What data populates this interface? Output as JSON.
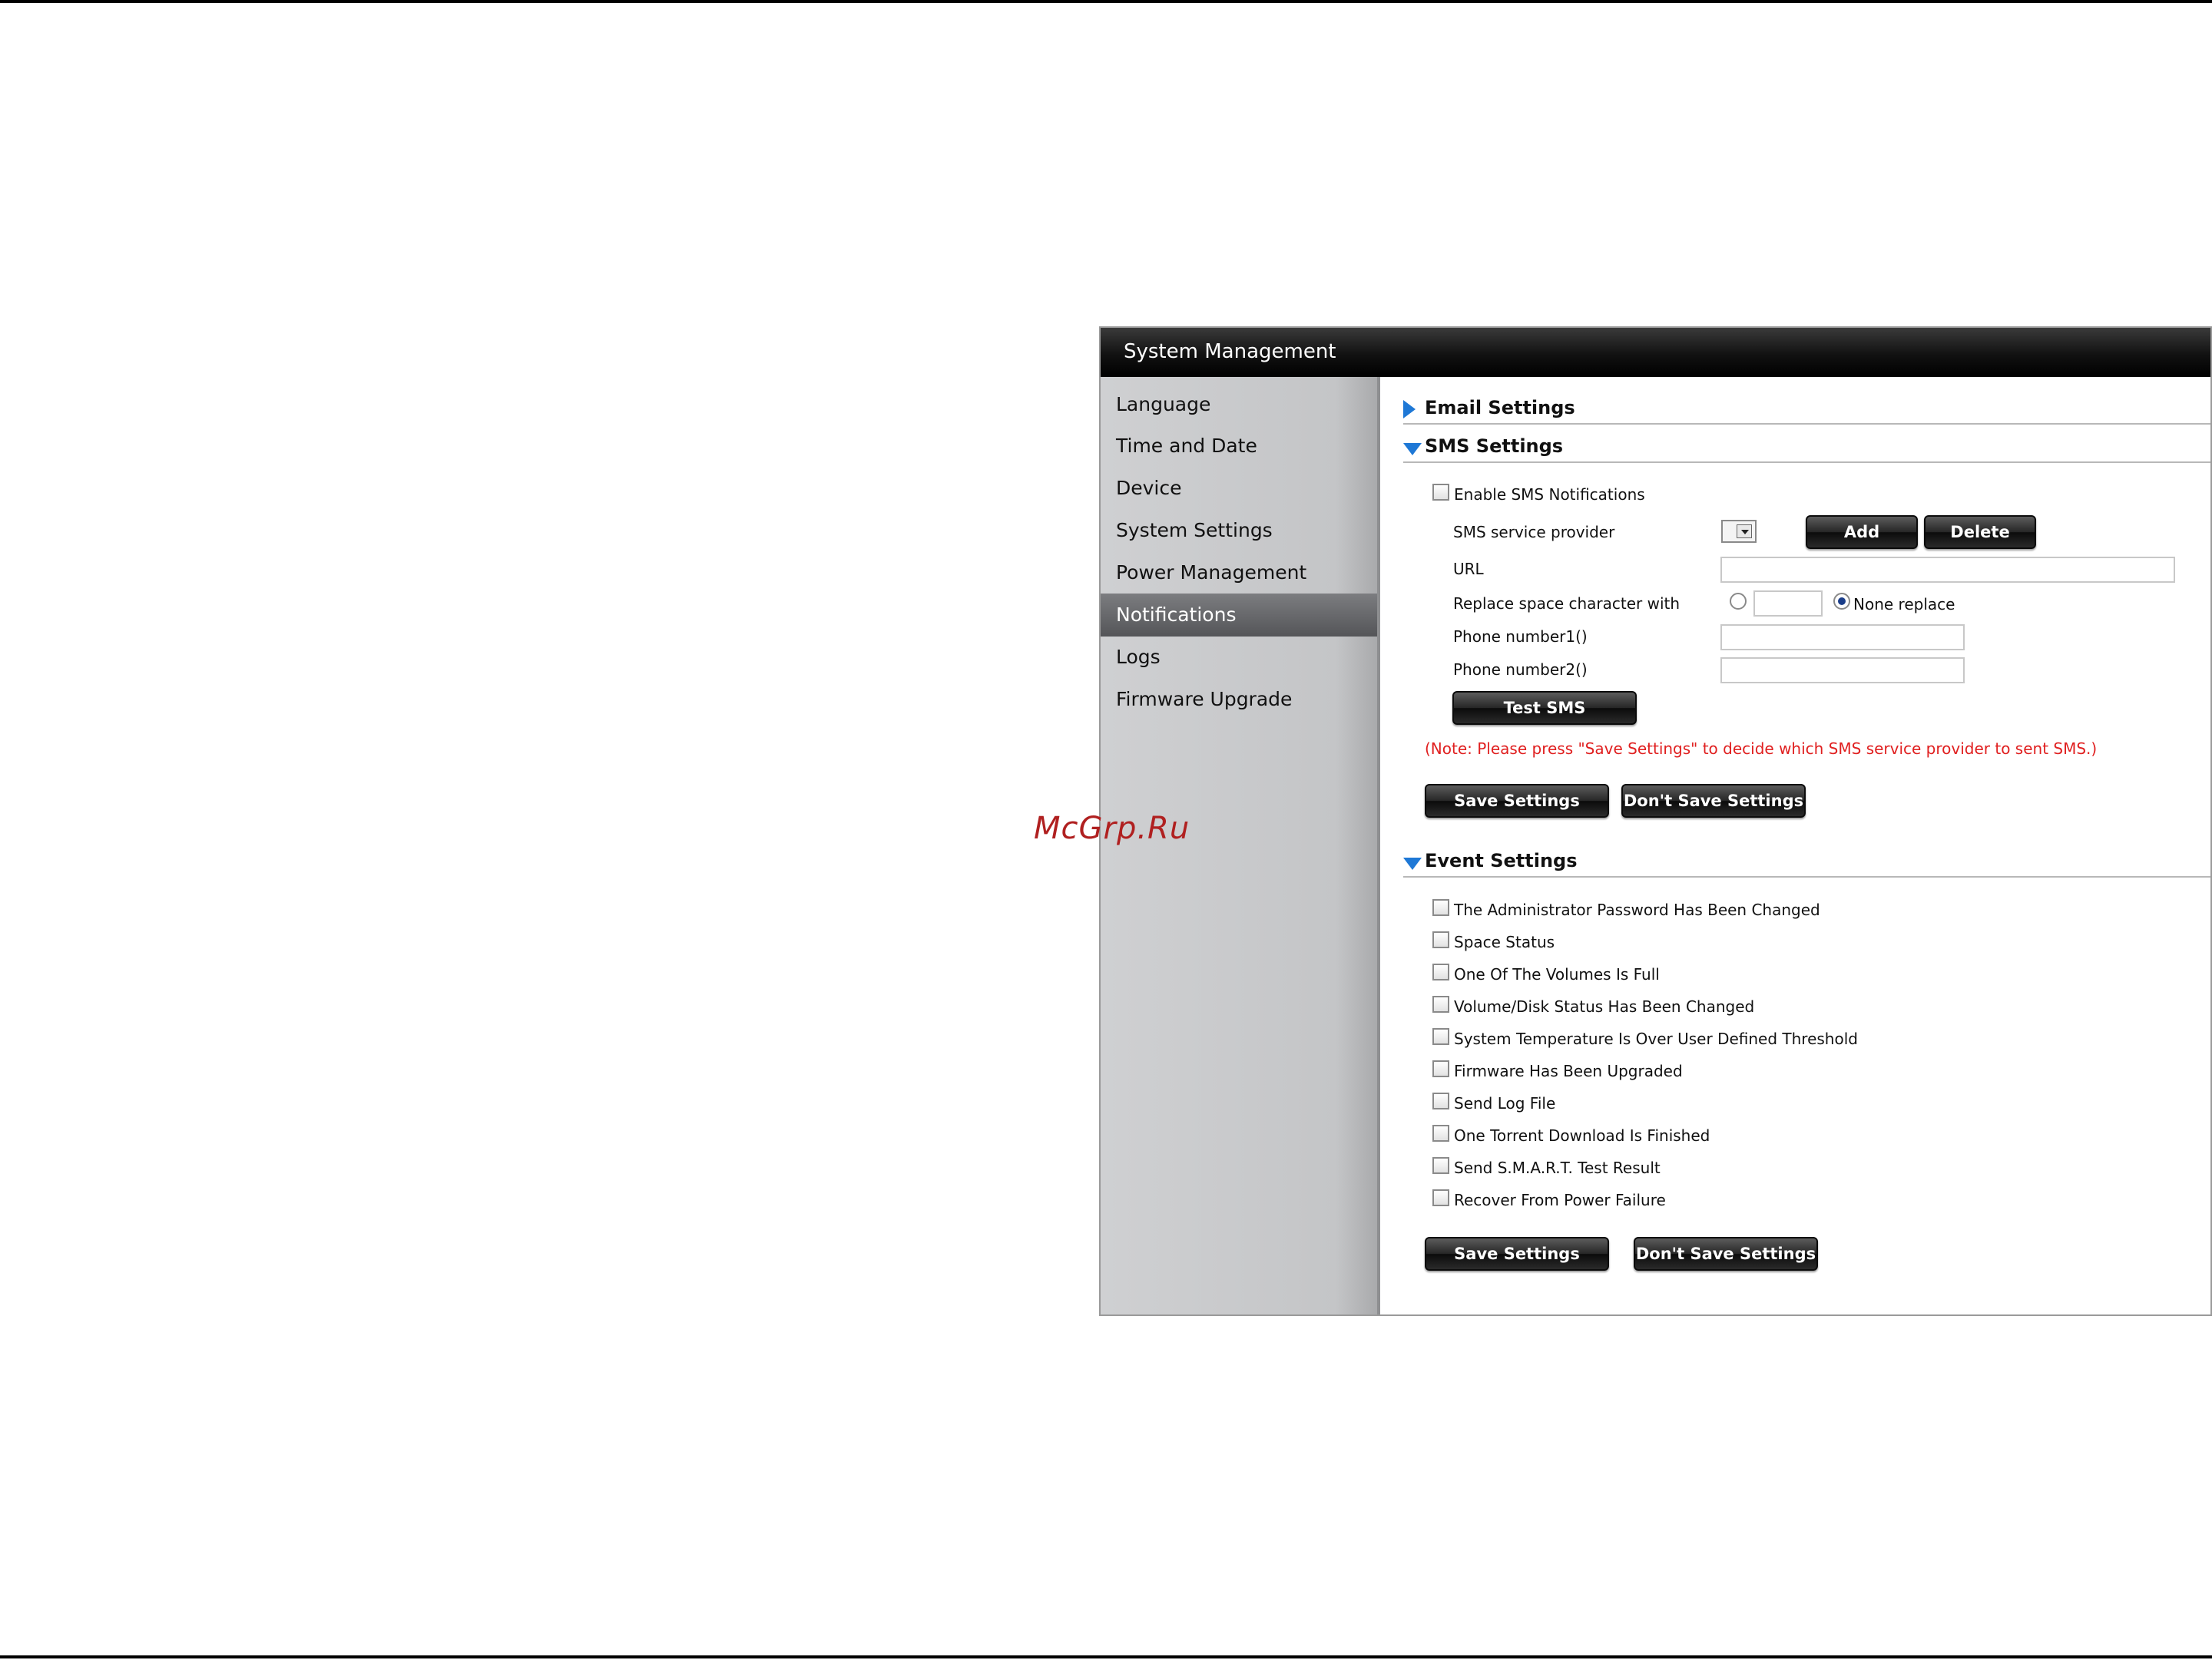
{
  "window": {
    "title": "System Management"
  },
  "sidebar": {
    "items": [
      {
        "label": "Language",
        "active": false
      },
      {
        "label": "Time and Date",
        "active": false
      },
      {
        "label": "Device",
        "active": false
      },
      {
        "label": "System Settings",
        "active": false
      },
      {
        "label": "Power Management",
        "active": false
      },
      {
        "label": "Notifications",
        "active": true
      },
      {
        "label": "Logs",
        "active": false
      },
      {
        "label": "Firmware Upgrade",
        "active": false
      }
    ]
  },
  "email_settings": {
    "title": "Email Settings",
    "expanded": false
  },
  "sms_settings": {
    "title": "SMS Settings",
    "expanded": true,
    "enable_label": "Enable SMS Notifications",
    "enable_checked": false,
    "provider_label": "SMS service provider",
    "provider_value": "",
    "add_button": "Add",
    "delete_button": "Delete",
    "url_label": "URL",
    "url_value": "",
    "replace_label": "Replace space character with",
    "replace_value": "",
    "none_replace_label": "None replace",
    "none_replace_selected": true,
    "phone1_label": "Phone number1()",
    "phone1_value": "",
    "phone2_label": "Phone number2()",
    "phone2_value": "",
    "test_button": "Test SMS",
    "note": "(Note: Please press \"Save Settings\" to decide which SMS service provider to sent SMS.)",
    "save_button": "Save Settings",
    "dont_save_button": "Don't Save Settings"
  },
  "event_settings": {
    "title": "Event Settings",
    "expanded": true,
    "events": [
      {
        "label": "The Administrator Password Has Been Changed",
        "checked": false
      },
      {
        "label": "Space Status",
        "checked": false
      },
      {
        "label": "One Of The Volumes Is Full",
        "checked": false
      },
      {
        "label": "Volume/Disk Status Has Been Changed",
        "checked": false
      },
      {
        "label": "System Temperature Is Over User Defined Threshold",
        "checked": false
      },
      {
        "label": "Firmware Has Been Upgraded",
        "checked": false
      },
      {
        "label": "Send Log File",
        "checked": false
      },
      {
        "label": "One Torrent Download Is Finished",
        "checked": false
      },
      {
        "label": "Send S.M.A.R.T. Test Result",
        "checked": false
      },
      {
        "label": "Recover From Power Failure",
        "checked": false
      }
    ],
    "save_button": "Save Settings",
    "dont_save_button": "Don't Save Settings"
  },
  "watermark": "McGrp.Ru",
  "colors": {
    "accent_triangle": "#1e78d6",
    "note_red": "#e02020",
    "titlebar": "#000000",
    "sidebar": "#c4c5c7"
  }
}
